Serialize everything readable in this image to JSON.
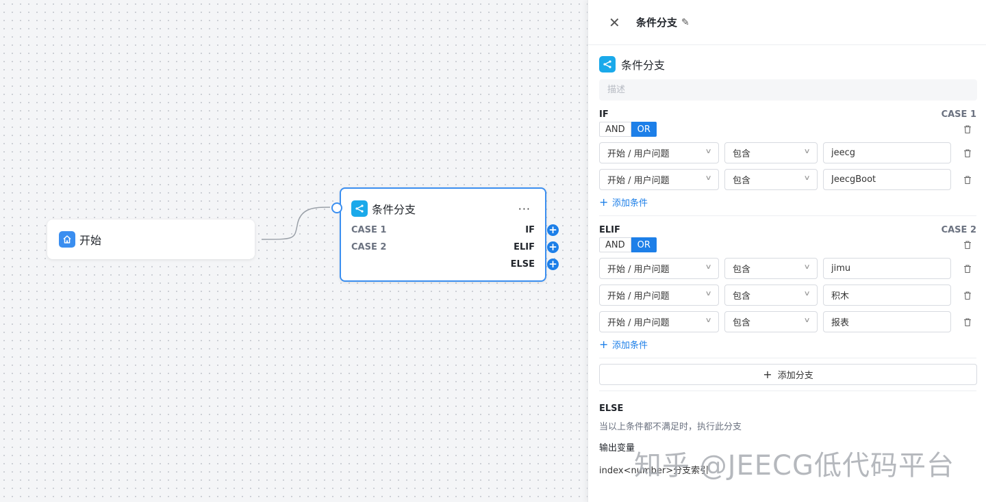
{
  "canvas": {
    "start_node": {
      "title": "开始",
      "icon": "home-icon"
    },
    "condition_node": {
      "title": "条件分支",
      "icon": "branch-icon",
      "more": "···",
      "rows": [
        {
          "case": "CASE 1",
          "keyword": "IF"
        },
        {
          "case": "CASE 2",
          "keyword": "ELIF"
        },
        {
          "case": "",
          "keyword": "ELSE"
        }
      ],
      "handle_symbol": "+"
    }
  },
  "panel": {
    "header": {
      "title": "条件分支",
      "close_icon": "close-icon",
      "edit_icon": "edit-icon"
    },
    "section_title": "条件分支",
    "description_placeholder": "描述",
    "branches": [
      {
        "label": "IF",
        "case": "CASE 1",
        "logic": {
          "and": "AND",
          "or": "OR",
          "active": "OR"
        },
        "conditions": [
          {
            "variable": "开始 / 用户问题",
            "operator": "包含",
            "value": "jeecg"
          },
          {
            "variable": "开始 / 用户问题",
            "operator": "包含",
            "value": "JeecgBoot"
          }
        ],
        "add_condition": "添加条件"
      },
      {
        "label": "ELIF",
        "case": "CASE 2",
        "logic": {
          "and": "AND",
          "or": "OR",
          "active": "OR"
        },
        "conditions": [
          {
            "variable": "开始 / 用户问题",
            "operator": "包含",
            "value": "jimu"
          },
          {
            "variable": "开始 / 用户问题",
            "operator": "包含",
            "value": "积木"
          },
          {
            "variable": "开始 / 用户问题",
            "operator": "包含",
            "value": "报表"
          }
        ],
        "add_condition": "添加条件"
      }
    ],
    "add_branch": "添加分支",
    "else": {
      "title": "ELSE",
      "description": "当以上条件都不满足时，执行此分支"
    },
    "output": {
      "title": "输出变量",
      "row": "index<number>分支索引"
    }
  },
  "watermark": "知乎 @JEECG低代码平台",
  "colors": {
    "accent": "#1d7fe8",
    "node_border": "#3a8ef0",
    "icon_cyan": "#1aa9ea"
  }
}
